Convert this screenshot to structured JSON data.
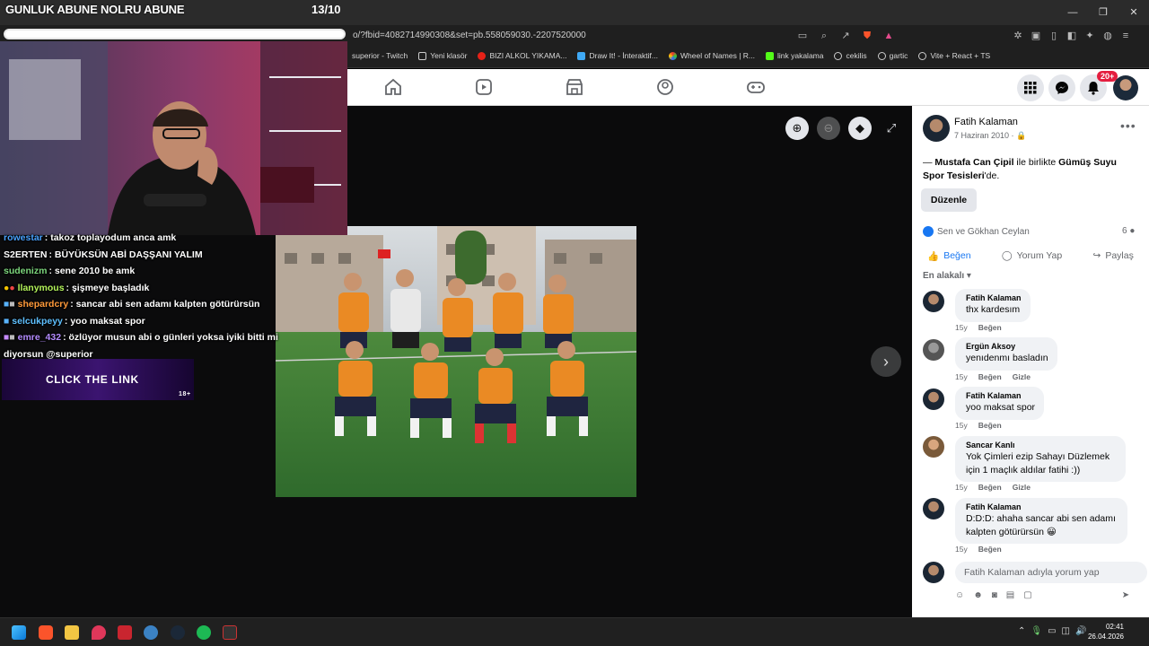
{
  "stream": {
    "title": "GUNLUK ABUNE NOLRU ABUNE",
    "count": "13/10",
    "chat": [
      {
        "user": "rowestar",
        "msg": "takoz toplayodum anca amk",
        "color": "#4aa3ff"
      },
      {
        "user": "S2ERTEN",
        "msg": "BÜYÜKSÜN ABİ DAŞŞANI YALIM",
        "color": "#ffffff"
      },
      {
        "user": "sudenizm",
        "msg": "sene 2010 be amk",
        "color": "#7cd67c"
      },
      {
        "user": "llanymous",
        "msg": "şişmeye başladık",
        "color": "#b3f25a"
      },
      {
        "user": "shepardcry",
        "msg": "sancar abi sen adamı kalpten götürürsün",
        "color": "#ff9a3a"
      },
      {
        "user": "selcukpeyy",
        "msg": "yoo maksat spor",
        "color": "#5fc0ff"
      },
      {
        "user": "emre_432",
        "msg": "özlüyor musun abi o günleri yoksa iyiki bitti mi diyorsun @superior",
        "color": "#b48cff"
      }
    ],
    "banner": "CLICK THE LINK",
    "banner_age": "18+"
  },
  "browser": {
    "url": "o/?fbid=4082714990308&set=pb.558059030.-2207520000",
    "bookmarks": [
      "superior - Twitch",
      "Yeni klasör",
      "BIZI ALKOL YIKAMA...",
      "Draw It! - İnteraktif...",
      "Wheel of Names | R...",
      "link yakalama",
      "cekilis",
      "gartic",
      "Vite + React + TS"
    ]
  },
  "fb": {
    "notif_badge": "20+",
    "author": "Fatih Kalaman",
    "date": "7 Haziran 2010",
    "with_prefix": "— ",
    "with_person": "Mustafa Can Çipil",
    "with_mid": " ile birlikte ",
    "with_place": "Gümüş Suyu Spor Tesisleri",
    "with_suffix": "'de.",
    "edit_label": "Düzenle",
    "reactions_text": "Sen ve Gökhan Ceylan",
    "comment_count": "6",
    "actions": {
      "like": "Beğen",
      "comment": "Yorum Yap",
      "share": "Paylaş"
    },
    "sort_label": "En alakalı",
    "comments": [
      {
        "name": "Fatih Kalaman",
        "text": "thx kardesım",
        "age": "15y",
        "like": "Beğen",
        "hide": ""
      },
      {
        "name": "Ergün Aksoy",
        "text": "yenıdenmı basladın",
        "age": "15y",
        "like": "Beğen",
        "hide": "Gizle"
      },
      {
        "name": "Fatih Kalaman",
        "text": "yoo maksat spor",
        "age": "15y",
        "like": "Beğen",
        "hide": ""
      },
      {
        "name": "Sancar Kanlı",
        "text": "Yok Çimleri ezip Sahayı Düzlemek için 1 maçlık aldılar fatihi :))",
        "age": "15y",
        "like": "Beğen",
        "hide": "Gizle"
      },
      {
        "name": "Fatih Kalaman",
        "text": "D:D:D: ahaha sancar abi sen adamı kalpten götürürsün 😀",
        "age": "15y",
        "like": "Beğen",
        "hide": ""
      }
    ],
    "compose_placeholder": "Fatih Kalaman adıyla yorum yap"
  },
  "taskbar": {
    "time": "02:41",
    "date": "26.04.2026"
  }
}
